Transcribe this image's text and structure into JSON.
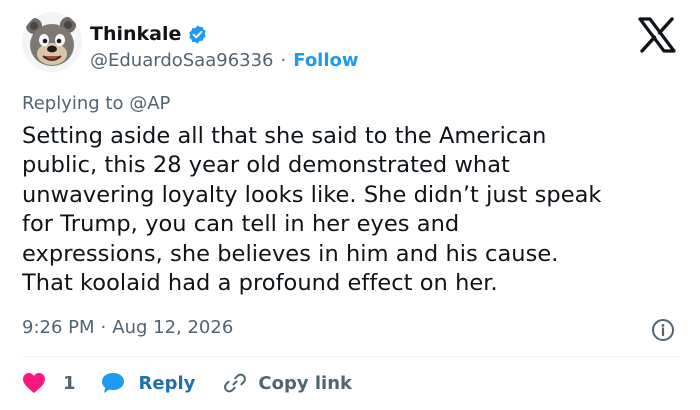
{
  "author": {
    "name": "Thinkale",
    "handle": "@EduardoSaa96336",
    "separator": "·",
    "follow_label": "Follow",
    "avatar_icon": "bear-avatar",
    "verified_icon": "verified-badge-icon"
  },
  "platform_logo": "x-logo",
  "reply_context": {
    "prefix": "Replying to",
    "mention": "@AP"
  },
  "tweet": {
    "lines": [
      "Setting aside all that she said to the American",
      "public, this 28 year old demonstrated what",
      "unwavering loyalty looks like. She didn’t just speak",
      "for Trump, you can tell in her eyes and",
      "expressions, she believes in him and his cause.",
      "That koolaid had a profound effect on her."
    ]
  },
  "meta": {
    "time": "9:26 PM",
    "separator": "·",
    "date": "Aug 12, 2026"
  },
  "actions": {
    "like_count": "1",
    "reply_label": "Reply",
    "copy_label": "Copy link"
  },
  "colors": {
    "accent": "#1d9bf0",
    "reply": "#1d72ae",
    "like": "#f91880",
    "muted": "#536471",
    "text": "#0f1419"
  }
}
